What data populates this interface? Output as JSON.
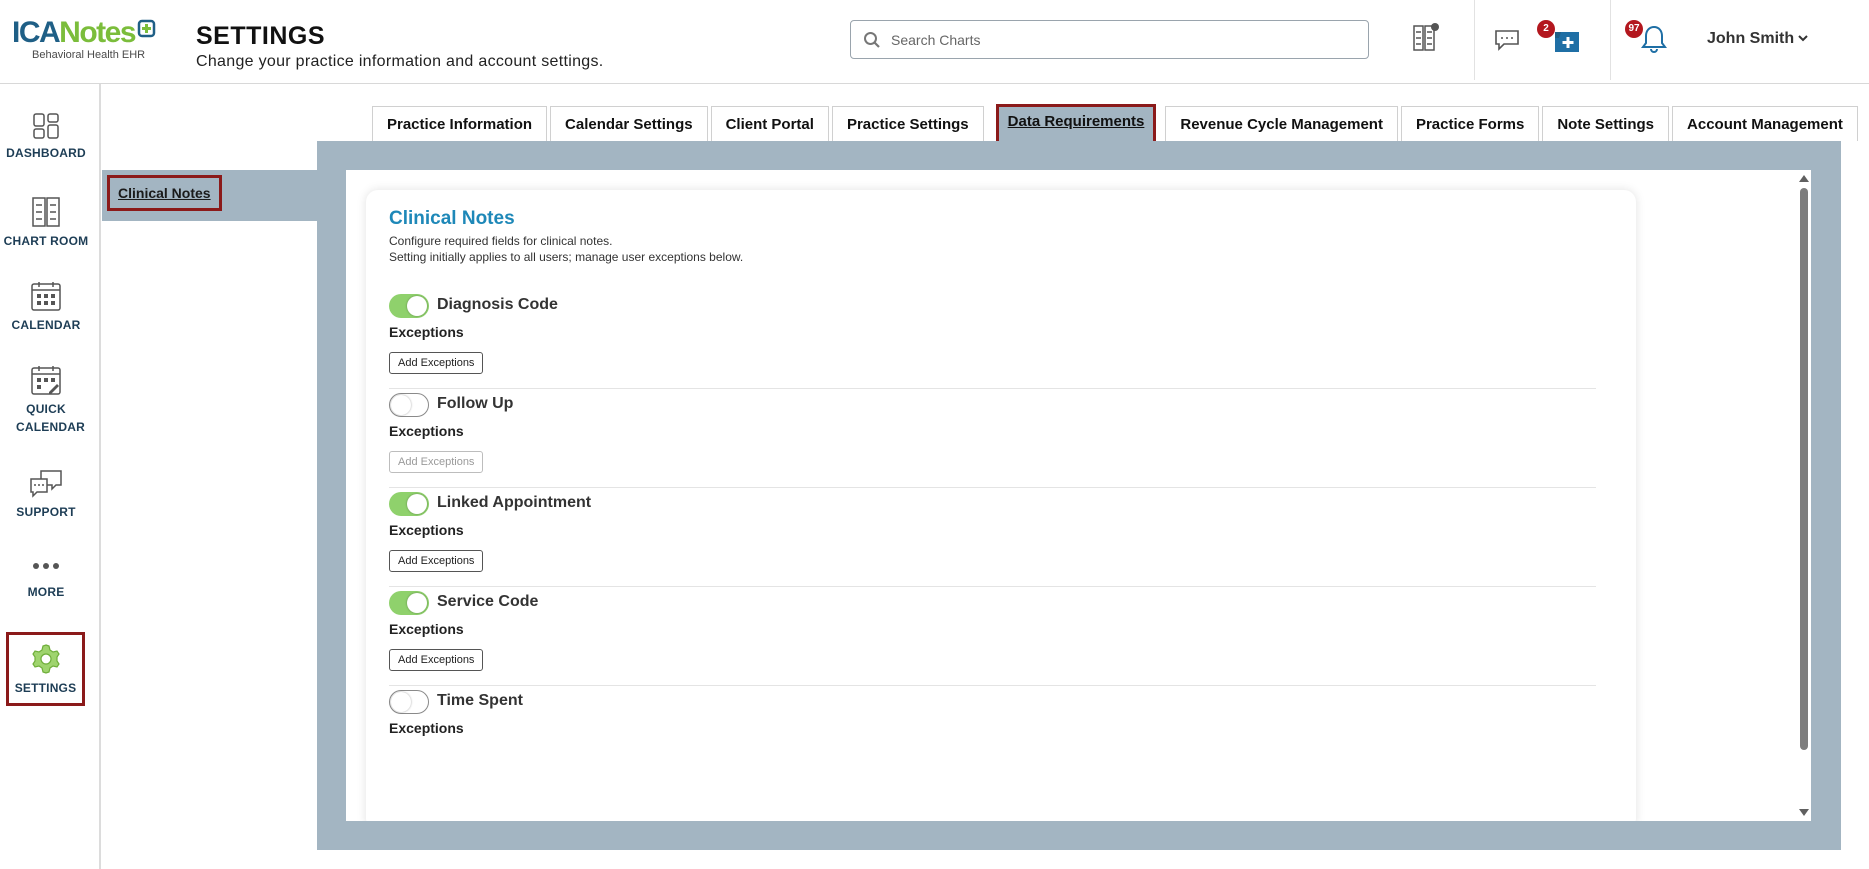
{
  "app": {
    "logo_text_a": "ICA",
    "logo_text_b": "Notes",
    "logo_sub": "Behavioral Health EHR"
  },
  "header": {
    "title": "SETTINGS",
    "subtitle": "Change your practice information and account settings.",
    "search_placeholder": "Search Charts",
    "tasks_badge": "2",
    "notifications_badge": "97",
    "user_name": "John Smith"
  },
  "nav": {
    "items": [
      {
        "label": "DASHBOARD",
        "icon": "dashboard-icon"
      },
      {
        "label": "CHART ROOM",
        "icon": "chart-room-icon"
      },
      {
        "label": "CALENDAR",
        "icon": "calendar-icon"
      },
      {
        "label": "QUICK CALENDAR",
        "icon": "quick-calendar-icon"
      },
      {
        "label": "SUPPORT",
        "icon": "support-icon"
      },
      {
        "label": "MORE",
        "icon": "more-icon"
      },
      {
        "label": "SETTINGS",
        "icon": "gear-icon"
      }
    ]
  },
  "subnav": {
    "active": "Clinical Notes"
  },
  "tabs": [
    "Practice Information",
    "Calendar Settings",
    "Client Portal",
    "Practice Settings",
    "Data Requirements",
    "Revenue Cycle Management",
    "Practice Forms",
    "Note Settings",
    "Account Management"
  ],
  "active_tab": "Data Requirements",
  "colors": {
    "accent_title": "#1e88b8",
    "toggle_on": "#8fd16c",
    "highlight_border": "#8b1a1a",
    "frame_bg": "#a3b5c2",
    "badge": "#b3171e"
  },
  "clinical_notes": {
    "title": "Clinical Notes",
    "desc_line1": "Configure required fields for clinical notes.",
    "desc_line2": "Setting initially applies to all users; manage user exceptions below.",
    "exceptions_label": "Exceptions",
    "add_exceptions_label": "Add Exceptions",
    "requirements": [
      {
        "label": "Diagnosis Code",
        "enabled": true
      },
      {
        "label": "Follow Up",
        "enabled": false
      },
      {
        "label": "Linked Appointment",
        "enabled": true
      },
      {
        "label": "Service Code",
        "enabled": true
      },
      {
        "label": "Time Spent",
        "enabled": false
      }
    ]
  }
}
